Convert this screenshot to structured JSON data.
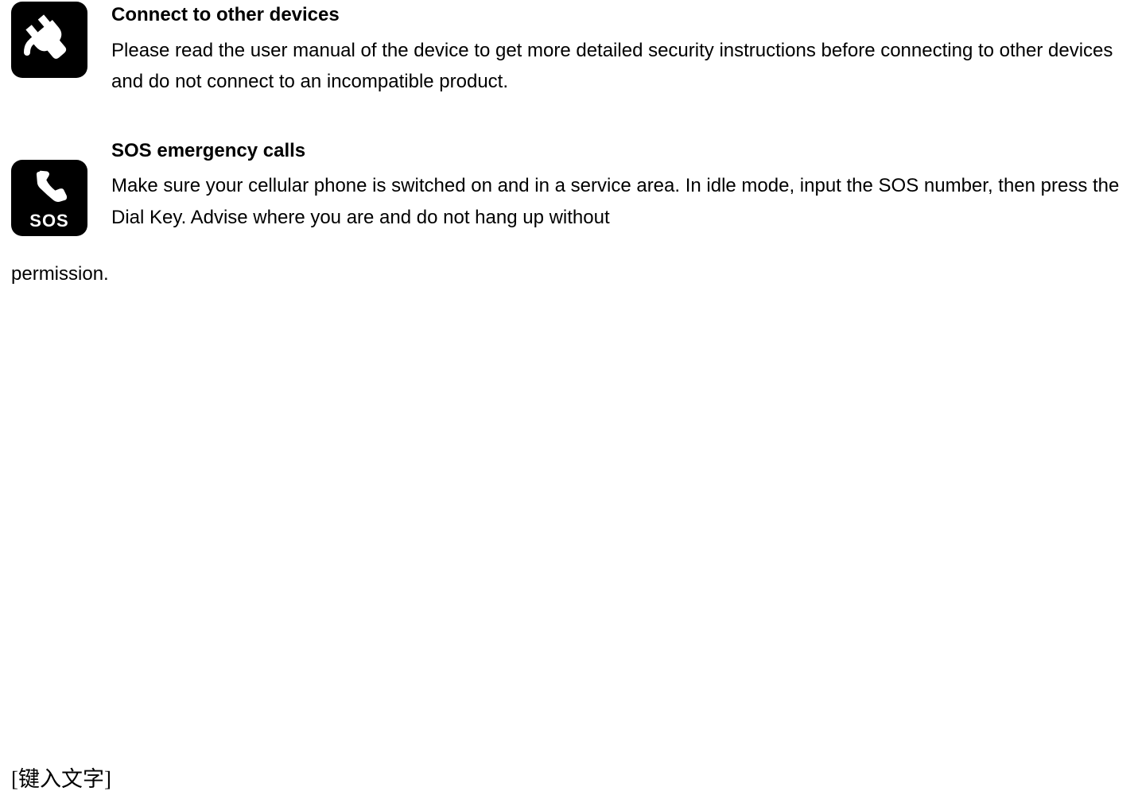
{
  "sections": [
    {
      "icon": "plug-icon",
      "heading": "Connect to other devices",
      "body": "Please read the user manual of the device to get more detailed security instructions before connecting to other devices and do not connect to an incompatible product."
    },
    {
      "icon": "sos-phone-icon",
      "icon_label": "SOS",
      "heading": "SOS emergency calls",
      "body_part1": "Make sure your cellular phone is switched on and in a service area. In idle mode, input the SOS number, then press the Dial Key. Advise where you are and do not hang up without",
      "body_part2": "permission."
    }
  ],
  "footer": "[键入文字]"
}
